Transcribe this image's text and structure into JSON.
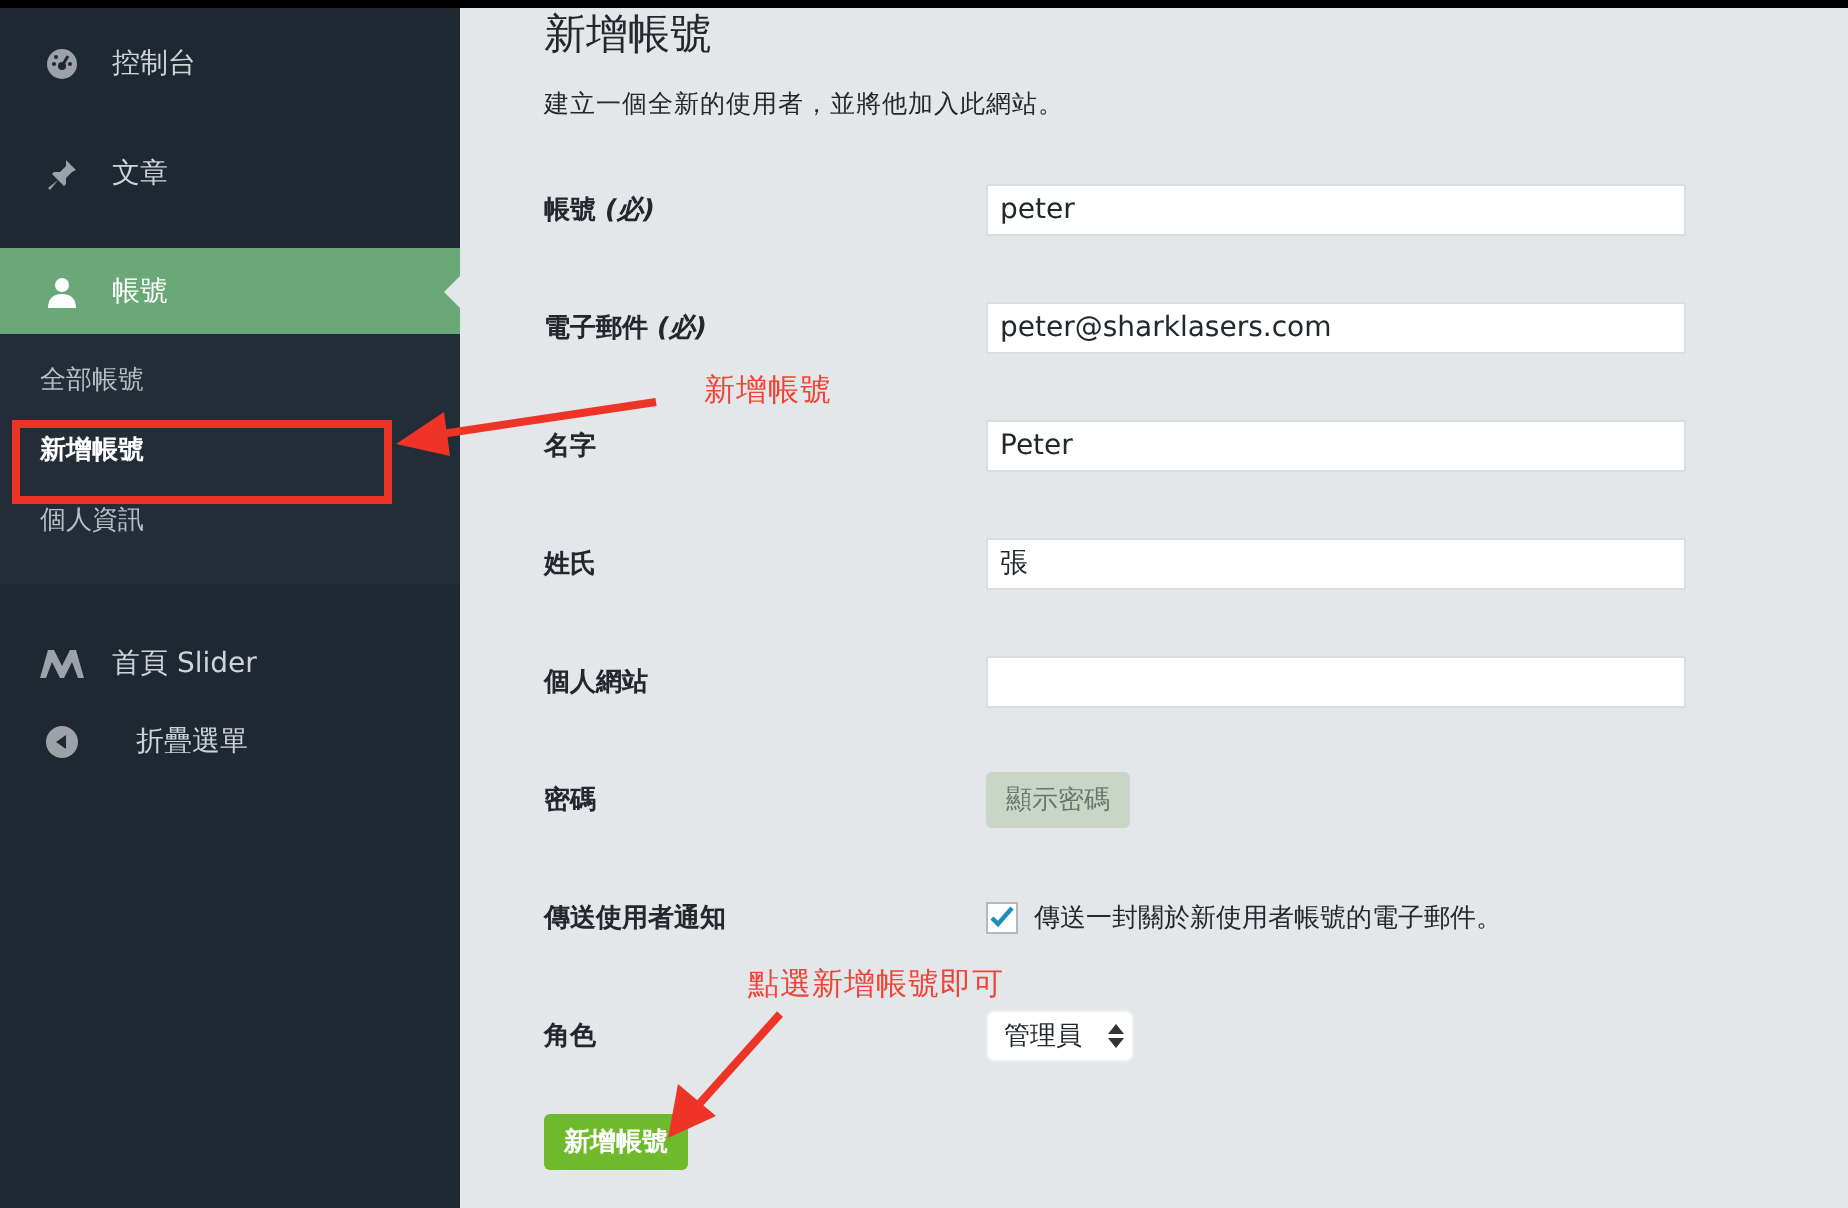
{
  "sidebar": {
    "items": [
      {
        "label": "控制台",
        "selected": false
      },
      {
        "label": "文章",
        "selected": false
      },
      {
        "label": "帳號",
        "selected": true,
        "children": [
          {
            "label": "全部帳號",
            "selected": false
          },
          {
            "label": "新增帳號",
            "selected": true
          },
          {
            "label": "個人資訊",
            "selected": false
          }
        ]
      },
      {
        "label": "首頁 Slider",
        "selected": false
      },
      {
        "label": "折疊選單",
        "selected": false
      }
    ]
  },
  "page": {
    "title": "新增帳號",
    "description": "建立一個全新的使用者，並將他加入此網站。"
  },
  "form": {
    "fields": [
      {
        "kind": "text",
        "label": "帳號",
        "required_mark": "(必)",
        "value": "peter"
      },
      {
        "kind": "text",
        "label": "電子郵件",
        "required_mark": "(必)",
        "value": "peter@sharklasers.com"
      },
      {
        "kind": "text",
        "label": "名字",
        "value": "Peter"
      },
      {
        "kind": "text",
        "label": "姓氏",
        "value": "張"
      },
      {
        "kind": "text",
        "label": "個人網站"
      },
      {
        "kind": "button",
        "label": "密碼",
        "button_label": "顯示密碼"
      },
      {
        "kind": "checkbox",
        "label": "傳送使用者通知",
        "checked": true,
        "text": "傳送一封關於新使用者帳號的電子郵件。"
      },
      {
        "kind": "select",
        "label": "角色",
        "value": "管理員"
      }
    ],
    "submit": "新增帳號"
  },
  "annotations": [
    {
      "text": "新增帳號"
    },
    {
      "text": "點選新增帳號即可"
    }
  ]
}
